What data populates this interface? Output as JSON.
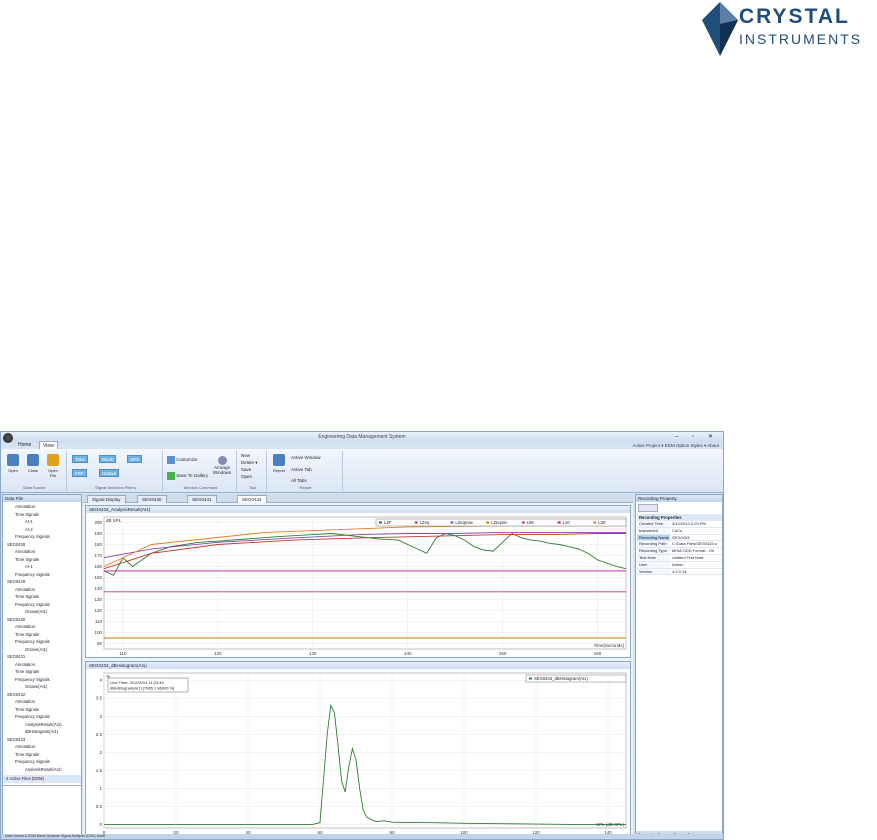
{
  "logo": {
    "line1": "CRYSTAL",
    "line2": "INSTRUMENTS"
  },
  "app": {
    "title": "Engineering Data Management System",
    "tabs": [
      "Home",
      "View"
    ],
    "topright": "Active Project ▾   EDM Option   Styles ▾   About",
    "ribbon": {
      "data_source": {
        "label": "Data Source",
        "buttons": [
          "Open",
          "Close",
          "Open File"
        ]
      },
      "signal_types": {
        "label": "Signal Selection Filters",
        "chips": [
          "Time",
          "Block",
          "APS",
          "FRF",
          "Octave"
        ]
      },
      "window_group": {
        "label": "Window Command",
        "buttons": [
          "Customize",
          "Save To Gallery",
          "Arrange Windows"
        ]
      },
      "tool_group": {
        "label": "Tool",
        "items": [
          "New",
          "Delete ▾",
          "Save",
          "Open"
        ]
      },
      "report_group": {
        "label": "Report",
        "items": [
          "Report",
          "Active Window",
          "Active Tab",
          "All Tabs"
        ]
      }
    },
    "left_panel": {
      "header": "Data File",
      "tree": [
        "Annotation",
        "Time Signals",
        "AI-1",
        "AI-2",
        "Frequency Signals",
        "SEG0428",
        "Annotation",
        "Time Signals",
        "AI-1",
        "Frequency Signals",
        "SEG0429",
        "Annotation",
        "Time Signals",
        "Frequency Signals",
        "Octave(AI1)",
        "SEG0430",
        "Annotation",
        "Time Signals",
        "Frequency Signals",
        "Octave(AI1)",
        "SEG0431",
        "Annotation",
        "Time Signals",
        "Frequency Signals",
        "Octave(AI1)",
        "SEG0432",
        "Annotation",
        "Time Signals",
        "Frequency Signals",
        "AnalysisResult(AI1)",
        "dBHistogram(AI1)",
        "SEG0433",
        "Annotation",
        "Time Signals",
        "Frequency Signals",
        "AnalysisResult(AI1)",
        "dBHistogram(AI1)"
      ],
      "selected_item": "SEG0433",
      "footer": "4 Active Files (EDM)"
    },
    "doc_tabs": [
      "Signal Display",
      "SEG0430",
      "SEG0431",
      "SEG0433"
    ],
    "active_doc_tab": "SEG0433",
    "plot1": {
      "header": "SEG0433_AnalysisResult(AI1)",
      "ylabel_short": "dB SPL",
      "legend": [
        "LZF",
        "LZeq",
        "LZeqmax",
        "LZeqmin",
        "LZE",
        "L90",
        "L10"
      ],
      "xlabel": "Time(Seconds)"
    },
    "plot2": {
      "header": "SEG0433_dBHistogram(AI1)",
      "cursor_readout": [
        "Line Time: 3/12/2014 11:23:49",
        "dBHistogram(AI1) [7965.1 86000 %]"
      ],
      "legend": [
        "SEG0433_dBHistogram(AI1)"
      ],
      "ylabel_short": "%",
      "xlabel": "SPL (dB SPL)"
    },
    "right_panel": {
      "header": "Recording Property",
      "section": "Recording Properties",
      "rows": [
        {
          "k": "Created Time",
          "v": "3/12/2014 2:20 PM"
        },
        {
          "k": "Instrument",
          "v": "CoCo"
        },
        {
          "k": "Recording Name",
          "v": "SEG0433"
        },
        {
          "k": "Recording Path",
          "v": "C:\\Data Files\\SEG0433.s"
        },
        {
          "k": "Recording Type",
          "v": "MISA ODD Format - Ori"
        },
        {
          "k": "Test Note",
          "v": "Untitled Test Note"
        },
        {
          "k": "User",
          "v": "Admin"
        },
        {
          "k": "Version",
          "v": "4.2.0.14"
        }
      ],
      "selected_row": 2,
      "footer": "Recording Property   Display Setups"
    },
    "statusbar": "Data Source   ▸   EDM   Basic Dynamic Signal Analyzer (DSA) Mode"
  },
  "chart_data": [
    {
      "type": "line",
      "title": "SEG0433_AnalysisResult(AI1)",
      "xlabel": "Time(Seconds)",
      "ylabel": "dB SPL",
      "xlim": [
        108,
        163
      ],
      "ylim": [
        85,
        205
      ],
      "x_ticks": [
        110,
        120,
        130,
        140,
        150,
        160
      ],
      "y_ticks": [
        90,
        100,
        110,
        120,
        130,
        140,
        150,
        160,
        170,
        180,
        190,
        200
      ],
      "series": [
        {
          "name": "LZF",
          "color": "#2e7d32",
          "x": [
            108,
            109,
            110,
            111,
            113,
            115,
            118,
            120,
            123,
            126,
            128,
            130,
            132,
            134,
            136,
            137,
            139,
            141,
            142,
            143,
            144,
            145,
            146,
            147,
            148,
            149,
            150,
            151,
            152,
            153,
            154,
            155,
            156,
            157,
            158,
            159,
            160,
            161,
            162,
            163
          ],
          "y": [
            156,
            152,
            168,
            160,
            172,
            178,
            182,
            183,
            185,
            187,
            188,
            189,
            190,
            188,
            186,
            185,
            184,
            176,
            172,
            186,
            190,
            188,
            184,
            178,
            175,
            174,
            182,
            190,
            186,
            184,
            183,
            181,
            180,
            178,
            176,
            172,
            166,
            163,
            160,
            158
          ]
        },
        {
          "name": "LZeq",
          "color": "#c0392b",
          "x": [
            108,
            113,
            120,
            128,
            135,
            140,
            145,
            150,
            155,
            160,
            163
          ],
          "y": [
            158,
            172,
            180,
            184,
            186,
            187,
            188,
            189,
            189,
            190,
            190
          ]
        },
        {
          "name": "LZeqmax",
          "color": "#8e44ad",
          "x": [
            108,
            113,
            120,
            128,
            135,
            140,
            145,
            150,
            155,
            160,
            163
          ],
          "y": [
            168,
            176,
            182,
            186,
            189,
            190,
            190,
            191,
            191,
            191,
            191
          ]
        },
        {
          "name": "LZeqmin",
          "color": "#b8860b",
          "x": [
            108,
            163
          ],
          "y": [
            95,
            95
          ]
        },
        {
          "name": "L90",
          "color": "#d6336c",
          "x": [
            108,
            163
          ],
          "y": [
            137,
            137
          ]
        },
        {
          "name": "L10",
          "color": "#c71585",
          "x": [
            108,
            163
          ],
          "y": [
            156,
            156
          ]
        },
        {
          "name": "LZE",
          "color": "#e67e22",
          "x": [
            108,
            113,
            125,
            140,
            150,
            163
          ],
          "y": [
            160,
            180,
            191,
            196,
            197,
            197
          ]
        }
      ]
    },
    {
      "type": "line",
      "title": "SEG0433_dBHistogram(AI1)",
      "xlabel": "SPL (dB SPL)",
      "ylabel": "%",
      "xlim": [
        0,
        145
      ],
      "ylim": [
        -0.1,
        4.2
      ],
      "x_ticks": [
        0,
        20,
        40,
        60,
        80,
        100,
        120,
        140
      ],
      "y_ticks": [
        0,
        0.5,
        1,
        1.5,
        2,
        2.5,
        3,
        3.5,
        4
      ],
      "series": [
        {
          "name": "SEG0433_dBHistogram(AI1)",
          "color": "#2e7d32",
          "x": [
            0,
            20,
            40,
            55,
            58,
            60,
            62,
            63,
            64,
            65,
            66,
            67,
            68,
            69,
            70,
            71,
            72,
            73,
            74,
            75,
            76,
            78,
            80,
            85,
            90,
            100,
            110,
            120,
            130,
            145
          ],
          "y": [
            0,
            0,
            0,
            0,
            0,
            0.05,
            2.5,
            3.3,
            3.1,
            2.2,
            1.2,
            0.9,
            1.6,
            2.1,
            1.8,
            1.0,
            0.4,
            0.2,
            0.15,
            0.1,
            0.08,
            0.1,
            0.06,
            0.05,
            0.05,
            0.03,
            0.02,
            0.01,
            0,
            0
          ]
        }
      ]
    }
  ]
}
